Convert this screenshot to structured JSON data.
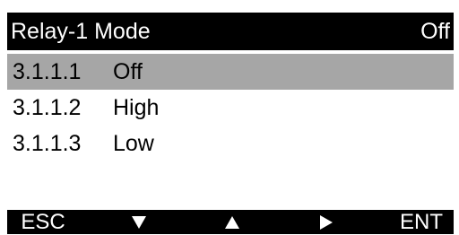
{
  "header": {
    "title": "Relay-1 Mode",
    "value": "Off"
  },
  "menu": {
    "items": [
      {
        "number": "3.1.1.1",
        "label": "Off",
        "selected": true
      },
      {
        "number": "3.1.1.2",
        "label": "High",
        "selected": false
      },
      {
        "number": "3.1.1.3",
        "label": "Low",
        "selected": false
      }
    ]
  },
  "softkeys": {
    "esc": "ESC",
    "down": "down-triangle-icon",
    "up": "up-triangle-icon",
    "right": "right-triangle-icon",
    "ent": "ENT"
  }
}
